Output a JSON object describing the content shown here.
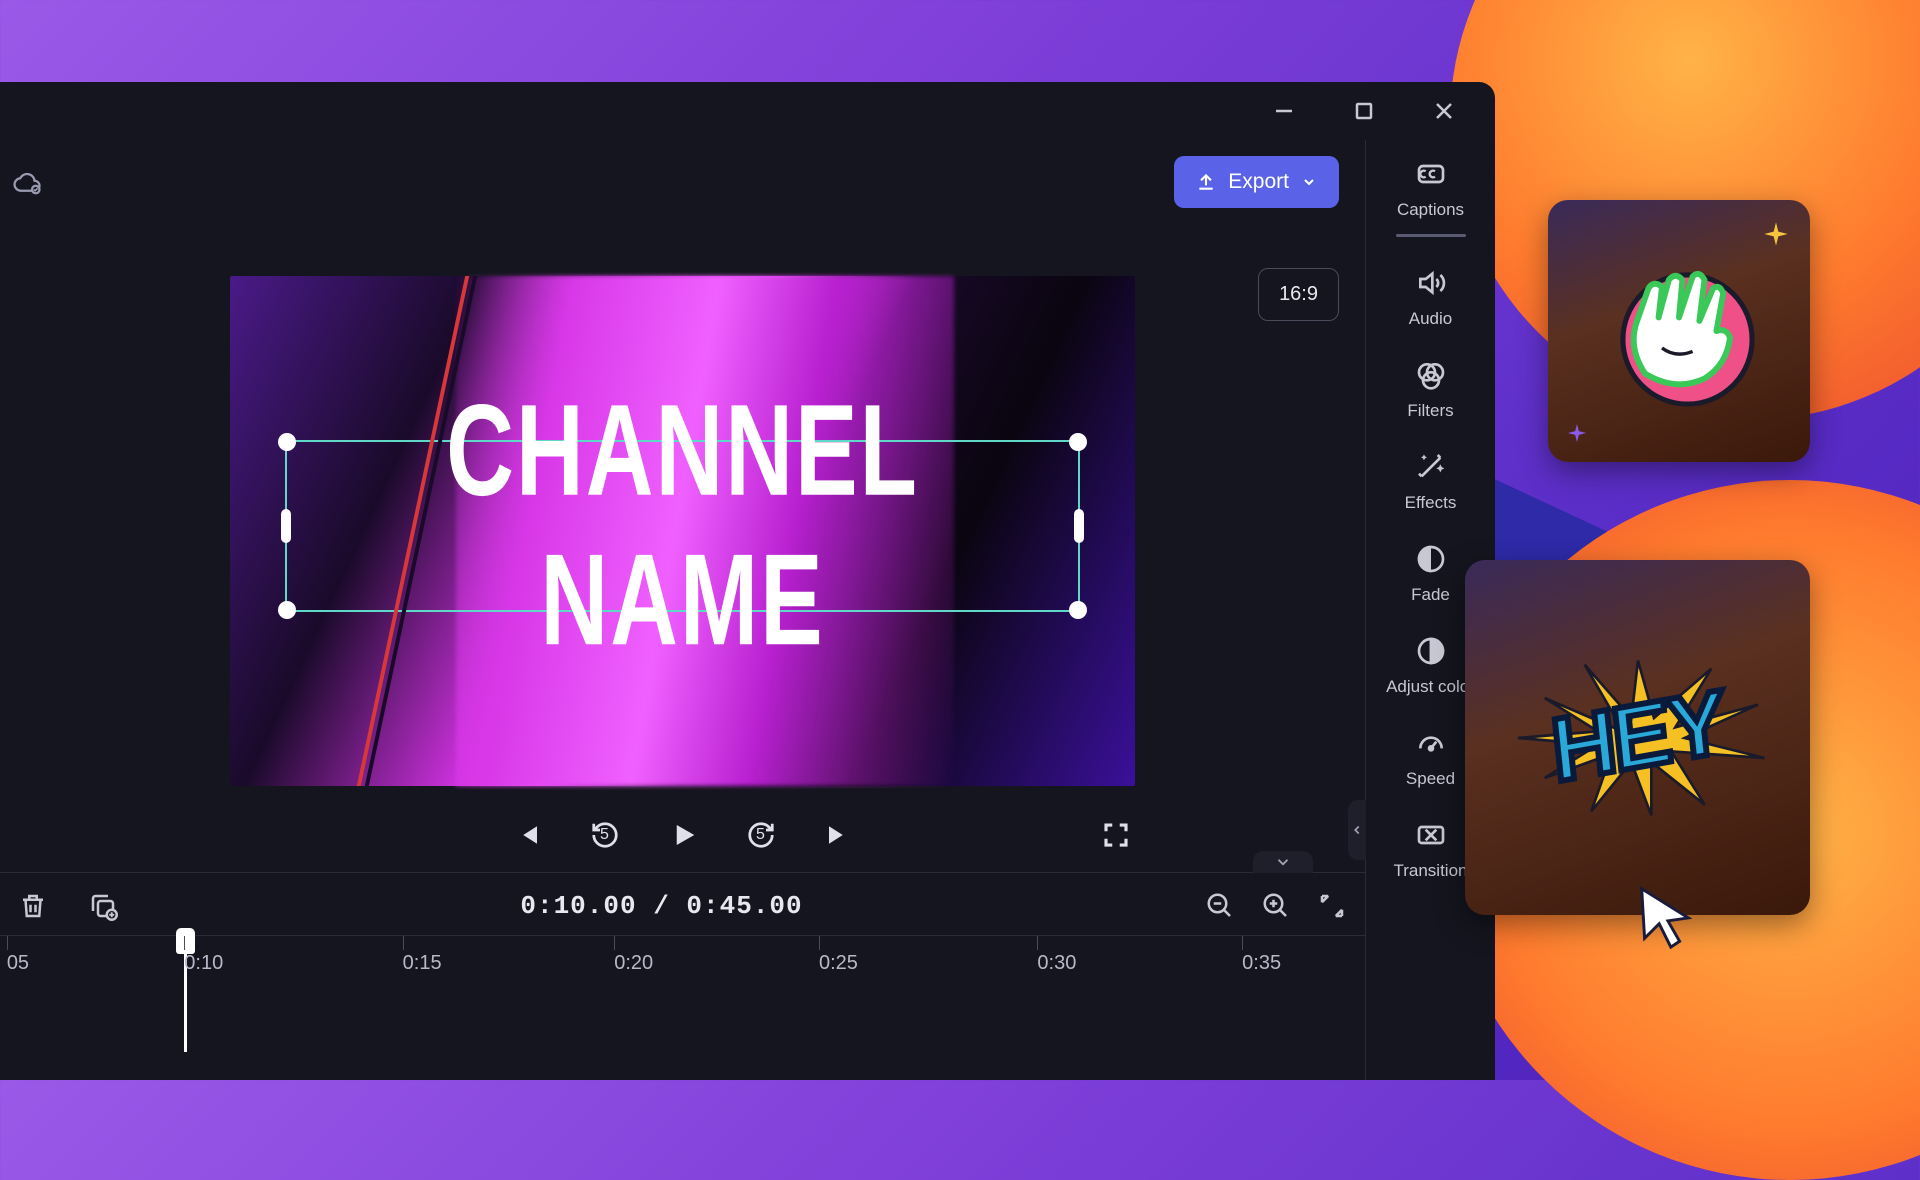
{
  "window": {
    "minimize": "minimize",
    "maximize": "maximize",
    "close": "close"
  },
  "toolbar": {
    "export_label": "Export",
    "aspect_label": "16:9"
  },
  "preview": {
    "overlay_text": "CHANNEL NAME"
  },
  "player": {
    "seek_back": "5",
    "seek_fwd": "5"
  },
  "timeline": {
    "current": "0:10.00",
    "total": "0:45.00",
    "separator": "/",
    "ticks": [
      "05",
      "0:10",
      "0:15",
      "0:20",
      "0:25",
      "0:30",
      "0:35"
    ],
    "tick_positions_pct": [
      0.5,
      13.5,
      29.5,
      45,
      60,
      76,
      91
    ]
  },
  "rail": {
    "items": [
      {
        "id": "captions",
        "label": "Captions"
      },
      {
        "id": "audio",
        "label": "Audio"
      },
      {
        "id": "filters",
        "label": "Filters"
      },
      {
        "id": "effects",
        "label": "Effects"
      },
      {
        "id": "fade",
        "label": "Fade"
      },
      {
        "id": "adjustcolor",
        "label": "Adjust color"
      },
      {
        "id": "speed",
        "label": "Speed"
      },
      {
        "id": "transition",
        "label": "Transition"
      }
    ]
  },
  "stickers": {
    "hey_text": "HEY"
  },
  "colors": {
    "accent": "#5a63e8"
  }
}
